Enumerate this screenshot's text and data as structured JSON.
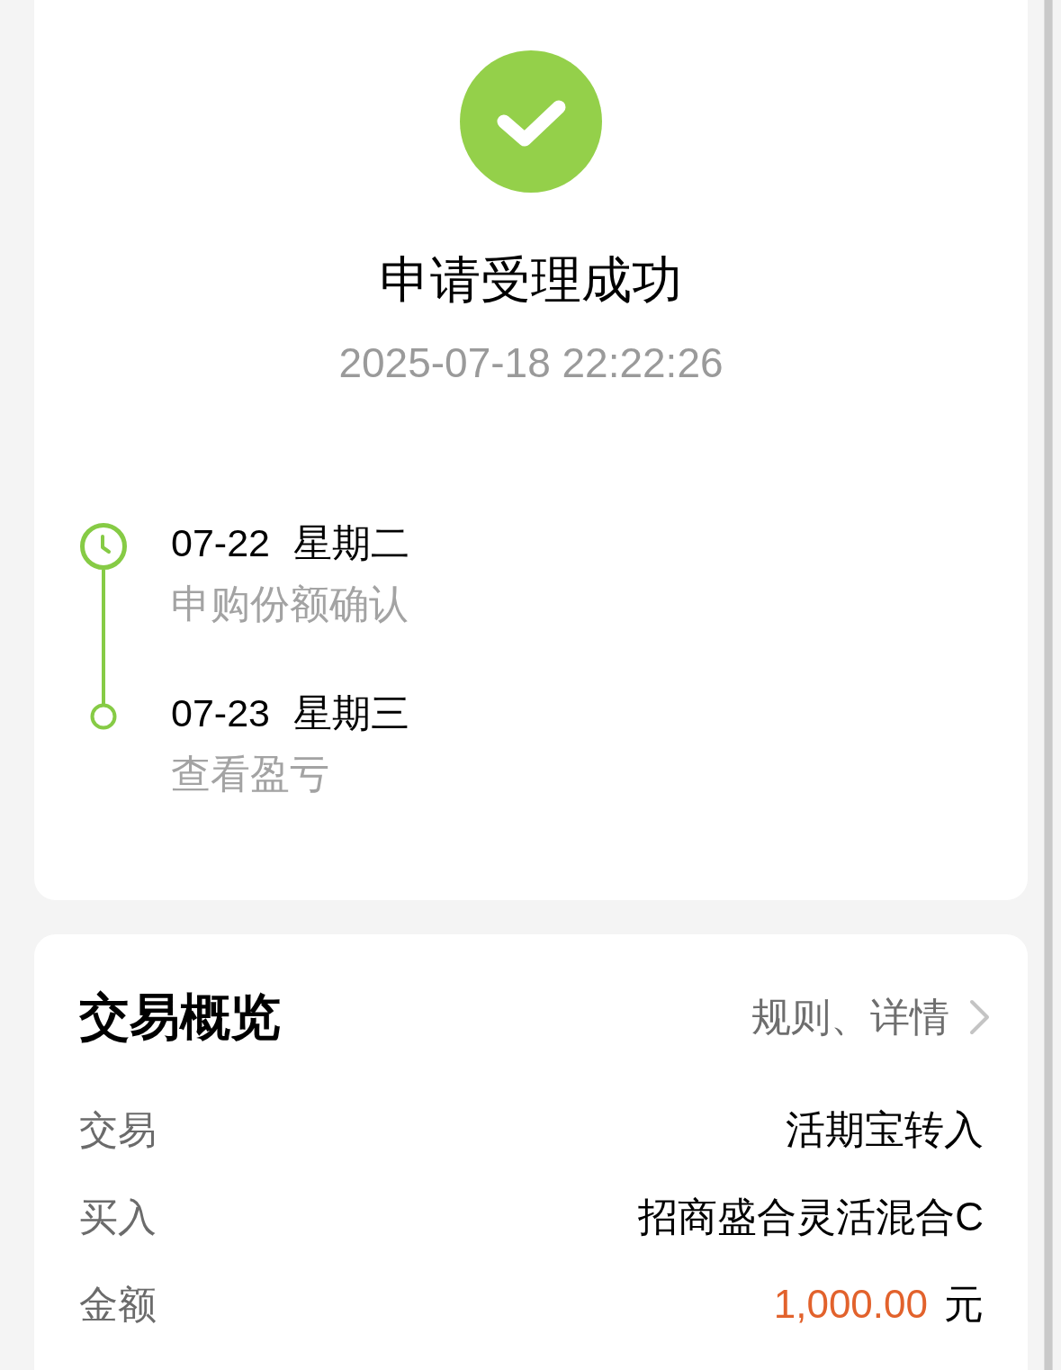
{
  "status": {
    "title": "申请受理成功",
    "time": "2025-07-18 22:22:26"
  },
  "timeline": [
    {
      "kind": "clock",
      "date": "07-22",
      "weekday": "星期二",
      "label": "申购份额确认"
    },
    {
      "kind": "ring",
      "date": "07-23",
      "weekday": "星期三",
      "label": "查看盈亏"
    }
  ],
  "overview": {
    "title": "交易概览",
    "link": "规则、详情",
    "rows": [
      {
        "kind": "text",
        "label": "交易",
        "value": "活期宝转入"
      },
      {
        "kind": "text",
        "label": "买入",
        "value": "招商盛合灵活混合C"
      },
      {
        "kind": "amount",
        "label": "金额",
        "value": "1,000.00",
        "unit": "元"
      }
    ]
  }
}
